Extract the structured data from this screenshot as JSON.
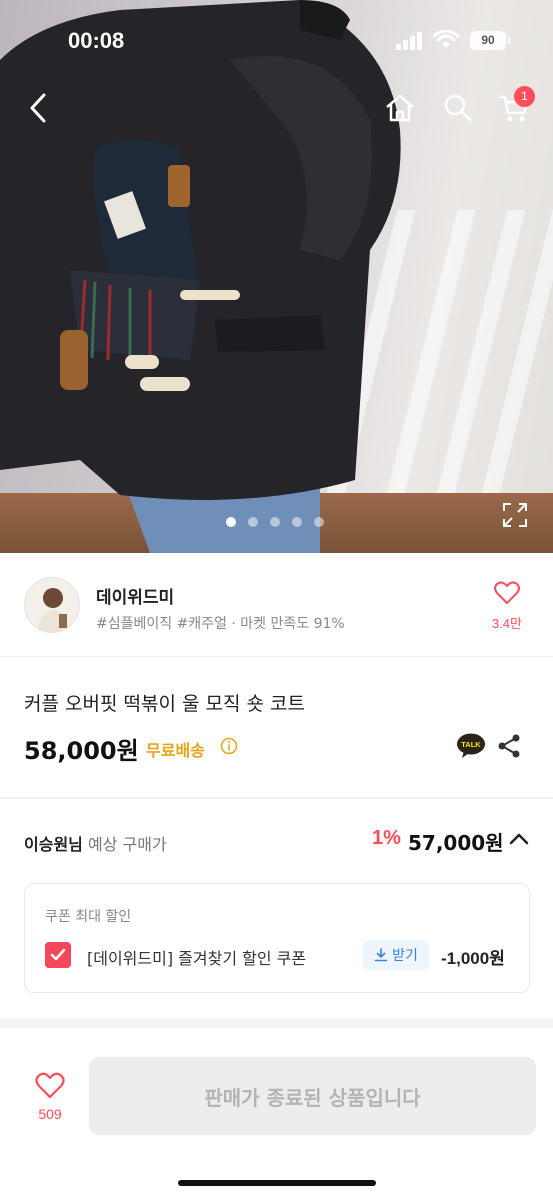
{
  "status_bar": {
    "time": "00:08",
    "battery": "90"
  },
  "header": {
    "cart_count": "1"
  },
  "gallery": {
    "total": 5,
    "active_index": 0
  },
  "shop": {
    "name": "데이위드미",
    "tags": "#심플베이직 #캐주얼 · 마켓 만족도 91%",
    "likes": "3.4만"
  },
  "product": {
    "title": "커플 오버핏 떡볶이 울 모직 숏 코트",
    "price": "58,000원",
    "shipping": "무료배송"
  },
  "expected": {
    "user": "이승원님",
    "label": "예상 구매가",
    "percent": "1%",
    "price": "57,000원"
  },
  "coupon": {
    "header": "쿠폰 최대 할인",
    "name": "[데이위드미] 즐겨찾기 할인 쿠폰",
    "get_label": "받기",
    "discount": "-1,000원",
    "checked": true
  },
  "bottom": {
    "likes": "509",
    "soldout_label": "판매가 종료된 상품입니다"
  },
  "colors": {
    "accent": "#ff4d5b",
    "shipping": "#e5a51b",
    "coupon_blue": "#3b82e6"
  }
}
